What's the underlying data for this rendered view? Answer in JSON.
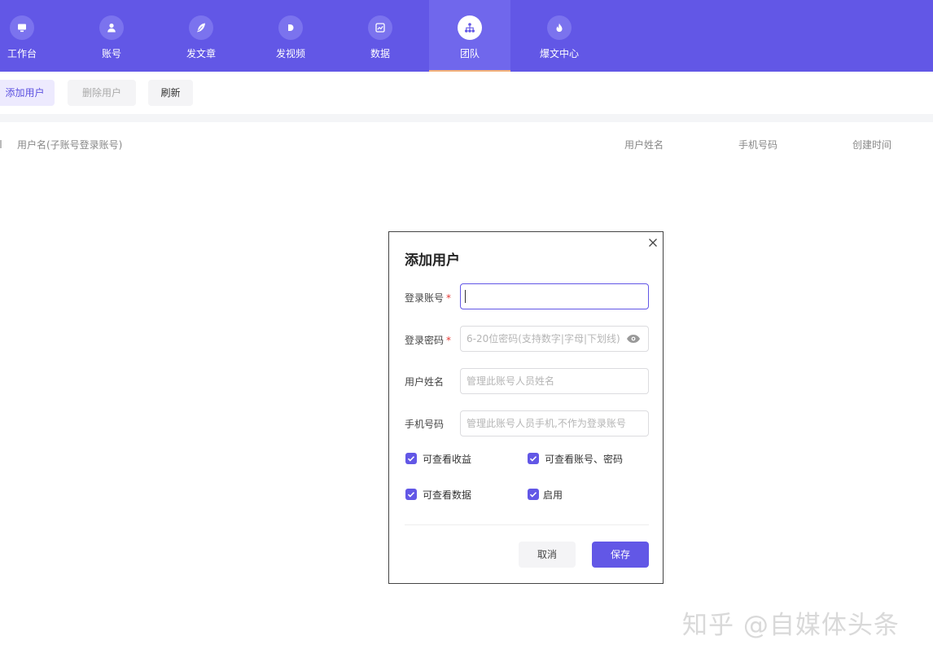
{
  "nav": {
    "items": [
      {
        "label": "工作台",
        "icon": "monitor-icon"
      },
      {
        "label": "账号",
        "icon": "user-icon"
      },
      {
        "label": "发文章",
        "icon": "feather-icon"
      },
      {
        "label": "发视频",
        "icon": "play-icon"
      },
      {
        "label": "数据",
        "icon": "chart-icon"
      },
      {
        "label": "团队",
        "icon": "team-icon",
        "active": true
      },
      {
        "label": "爆文中心",
        "icon": "fire-icon"
      }
    ]
  },
  "toolbar": {
    "add_label": "添加用户",
    "delete_label": "删除用户",
    "refresh_label": "刷新"
  },
  "table": {
    "headers": [
      "用户名(子账号登录账号)",
      "用户姓名",
      "手机号码",
      "创建时间"
    ]
  },
  "modal": {
    "title": "添加用户",
    "fields": {
      "login_account": {
        "label": "登录账号",
        "required_mark": "*",
        "value": "",
        "placeholder": ""
      },
      "login_password": {
        "label": "登录密码",
        "required_mark": "*",
        "placeholder": "6-20位密码(支持数字|字母|下划线)"
      },
      "user_name": {
        "label": "用户姓名",
        "placeholder": "管理此账号人员姓名"
      },
      "phone": {
        "label": "手机号码",
        "placeholder": "管理此账号人员手机,不作为登录账号"
      }
    },
    "checkboxes": [
      {
        "label": "可查看收益",
        "checked": true
      },
      {
        "label": "可查看账号、密码",
        "checked": true
      },
      {
        "label": "可查看数据",
        "checked": true
      },
      {
        "label": "启用",
        "checked": true
      }
    ],
    "cancel_label": "取消",
    "save_label": "保存"
  },
  "watermark": "知乎 @自媒体头条",
  "colors": {
    "accent": "#6257e6",
    "nav_bg": "#6257e6",
    "active_underline": "#f2b07a"
  }
}
